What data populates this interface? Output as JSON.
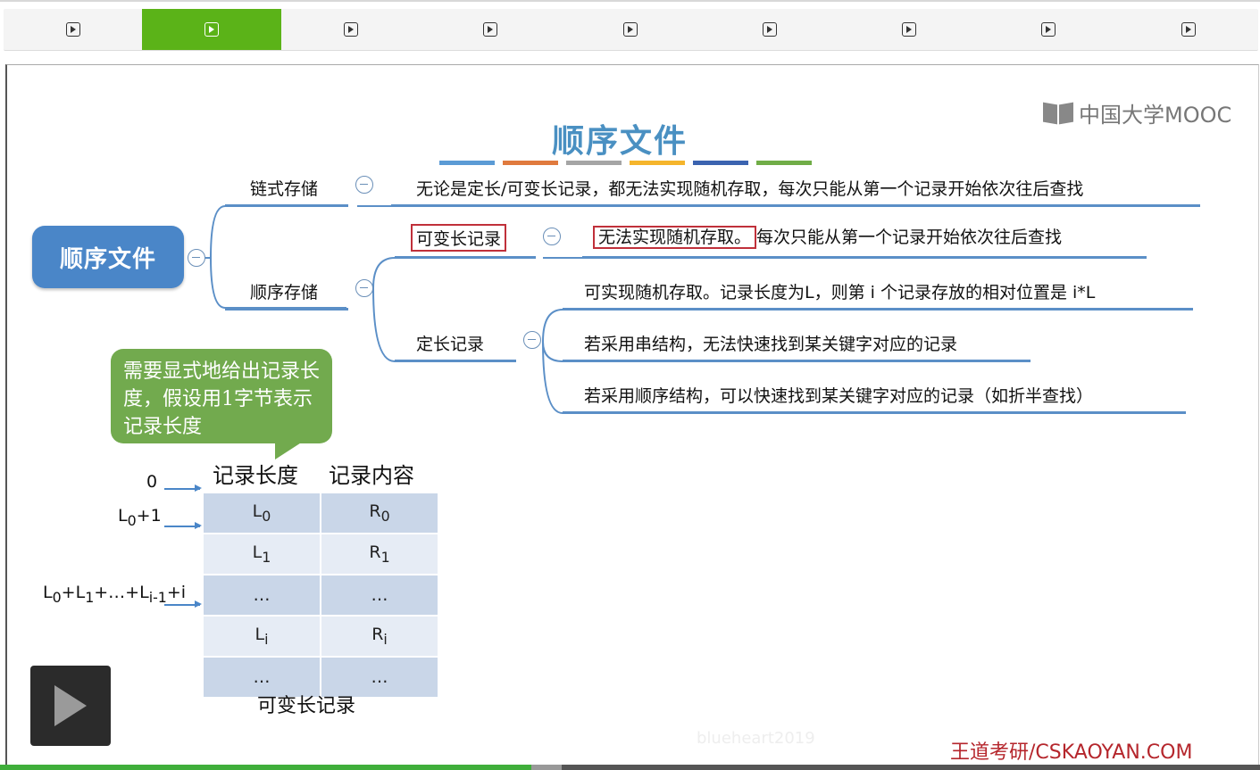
{
  "tabs": {
    "count": 9,
    "active_index": 1
  },
  "logo_text": "中国大学MOOC",
  "slide_title": "顺序文件",
  "title_bar_colors": [
    "#5b9bd5",
    "#e07a3e",
    "#a5a5a5",
    "#f5b52c",
    "#3b63b0",
    "#70ad47"
  ],
  "mindmap": {
    "root": "顺序文件",
    "chain_storage": "链式存储",
    "chain_desc": "无论是定长/可变长记录，都无法实现随机存取，每次只能从第一个记录开始依次往后查找",
    "seq_storage": "顺序存储",
    "variable_record": "可变长记录",
    "variable_desc_boxed": "无法实现随机存取。",
    "variable_desc_rest": "每次只能从第一个记录开始依次往后查找",
    "fixed_record": "定长记录",
    "fixed_desc_1": "可实现随机存取。记录长度为L，则第 i 个记录存放的相对位置是 i*L",
    "fixed_desc_2": "若采用串结构，无法快速找到某关键字对应的记录",
    "fixed_desc_3": "若采用顺序结构，可以快速找到某关键字对应的记录（如折半查找）"
  },
  "callout_text": "需要显式地给出记录长度，假设用1字节表示记录长度",
  "table": {
    "header_length": "记录长度",
    "header_content": "记录内容",
    "offsets": {
      "o0": "0",
      "o1": "L",
      "o1_sub": "0",
      "o1_tail": "+1"
    },
    "caption": "可变长记录"
  },
  "watermark": "blueheart2019",
  "brand": "王道考研/CSKAOYAN.COM",
  "player": {
    "progress_fraction": 0.422,
    "buffered_fraction": 0.446
  }
}
